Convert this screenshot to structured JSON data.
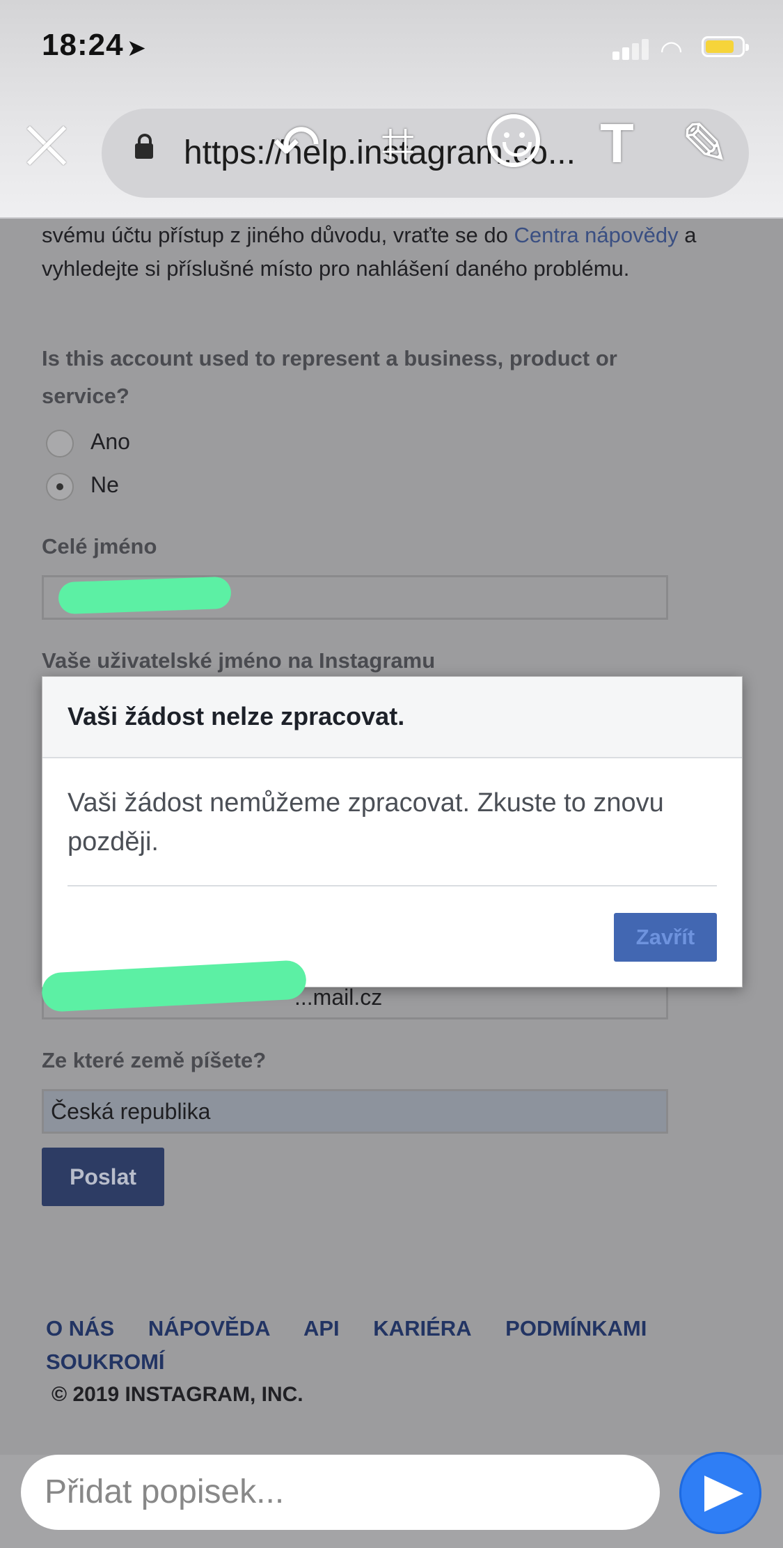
{
  "status_bar": {
    "time": "18:24",
    "location_arrow": "location-arrow-icon",
    "battery_color": "#f6d43a"
  },
  "browser": {
    "url": "https://help.instagram.co...",
    "tools": [
      "undo-icon",
      "crop-icon",
      "emoji-icon",
      "text-icon",
      "pencil-icon"
    ]
  },
  "page": {
    "intro_prefix": "svému účtu přístup z jiného důvodu, vraťte se do ",
    "intro_link": "Centra nápovědy",
    "intro_suffix": " a vyhledejte si příslušné místo pro nahlášení daného problému.",
    "business_question": "Is this account used to represent a business, product or service?",
    "options": [
      {
        "label": "Ano",
        "checked": false
      },
      {
        "label": "Ne",
        "checked": true
      }
    ],
    "full_name_label": "Celé jméno",
    "full_name_value": "",
    "username_label": "Vaše uživatelské jméno na Instagramu",
    "email_value_visible": "...mail.cz",
    "country_label": "Ze které země píšete?",
    "country_value": "Česká republika",
    "submit_label": "Poslat"
  },
  "footer": {
    "links": [
      "O NÁS",
      "NÁPOVĚDA",
      "API",
      "KARIÉRA",
      "PODMÍNKAMI",
      "SOUKROMÍ"
    ],
    "copyright": "© 2019 INSTAGRAM, INC."
  },
  "modal": {
    "title": "Vaši žádost nelze zpracovat.",
    "message": "Vaši žádost nemůžeme zpracovat. Zkuste to znovu později.",
    "close_label": "Zavřít",
    "button_color": "#4267b2"
  },
  "caption": {
    "placeholder": "Přidat popisek..."
  }
}
